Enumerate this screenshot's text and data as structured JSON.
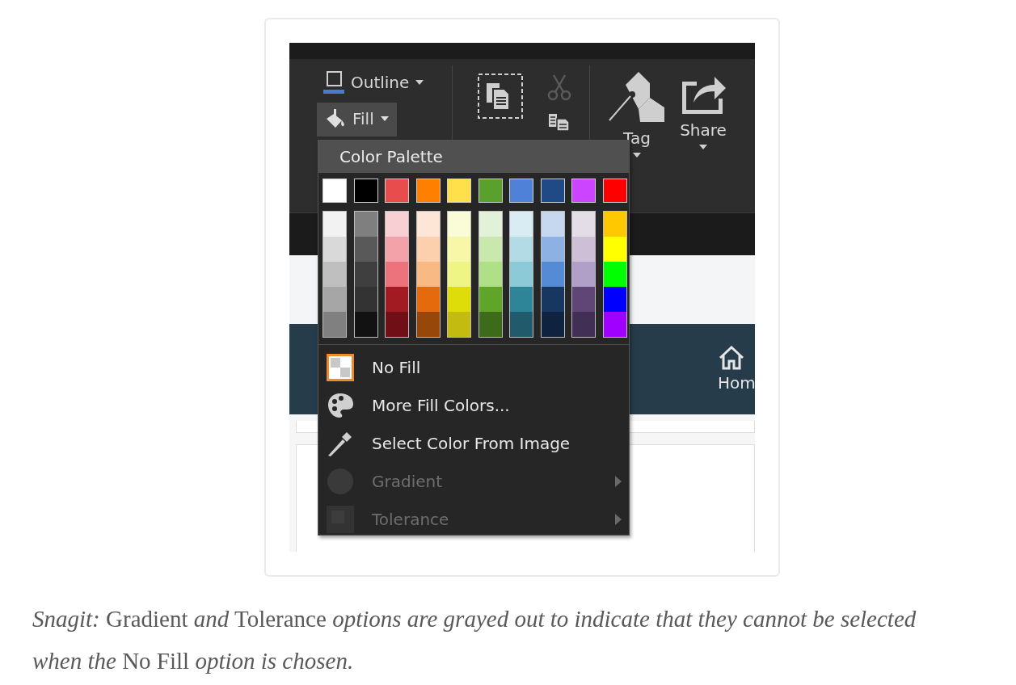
{
  "ribbon": {
    "outline": {
      "label": "Outline"
    },
    "fill": {
      "label": "Fill",
      "pressed": true
    },
    "tag": {
      "label": "Tag"
    },
    "share": {
      "label": "Share"
    }
  },
  "home_tab": {
    "label": "Hom"
  },
  "menu": {
    "title": "Color Palette",
    "base_colors": [
      {
        "color": "#ffffff"
      },
      {
        "color": "#000000"
      },
      {
        "color": "#e84c4c"
      },
      {
        "color": "#ff8000"
      },
      {
        "color": "#ffe04a"
      },
      {
        "color": "#5aa02c"
      },
      {
        "color": "#4f81d8"
      },
      {
        "color": "#1f4a86"
      },
      {
        "color": "#cc44ff"
      },
      {
        "color": "#ff0000"
      }
    ],
    "shade_columns": [
      {
        "swatches": [
          {
            "color": "#f2f2f2"
          },
          {
            "color": "#d9d9d9"
          },
          {
            "color": "#bfbfbf"
          },
          {
            "color": "#a6a6a6"
          },
          {
            "color": "#808080"
          }
        ]
      },
      {
        "swatches": [
          {
            "color": "#7f7f7f"
          },
          {
            "color": "#595959"
          },
          {
            "color": "#3f3f3f"
          },
          {
            "color": "#333333"
          },
          {
            "color": "#121212"
          }
        ]
      },
      {
        "swatches": [
          {
            "color": "#f8d0d3"
          },
          {
            "color": "#f2a2a8"
          },
          {
            "color": "#ec737c"
          },
          {
            "color": "#a31b22"
          },
          {
            "color": "#700f15"
          }
        ]
      },
      {
        "swatches": [
          {
            "color": "#fde6d6"
          },
          {
            "color": "#fcd0ad"
          },
          {
            "color": "#f9b984"
          },
          {
            "color": "#e56a0c"
          },
          {
            "color": "#974709"
          }
        ]
      },
      {
        "swatches": [
          {
            "color": "#fafcd8"
          },
          {
            "color": "#f8f7a8"
          },
          {
            "color": "#eef585"
          },
          {
            "color": "#dedd0a"
          },
          {
            "color": "#c3bb10"
          }
        ]
      },
      {
        "swatches": [
          {
            "color": "#e2f2d8"
          },
          {
            "color": "#c8e8ad"
          },
          {
            "color": "#afe085"
          },
          {
            "color": "#5ea528"
          },
          {
            "color": "#3c6b1a"
          }
        ]
      },
      {
        "swatches": [
          {
            "color": "#d9ecf3"
          },
          {
            "color": "#b2dbe6"
          },
          {
            "color": "#8ccad8"
          },
          {
            "color": "#2f8598"
          },
          {
            "color": "#205a6b"
          }
        ]
      },
      {
        "swatches": [
          {
            "color": "#c6d8f0"
          },
          {
            "color": "#8db1e2"
          },
          {
            "color": "#558ad4"
          },
          {
            "color": "#173660"
          },
          {
            "color": "#0f2240"
          }
        ]
      },
      {
        "swatches": [
          {
            "color": "#e3dde8"
          },
          {
            "color": "#ccbfd6"
          },
          {
            "color": "#b09fc6"
          },
          {
            "color": "#5f4676"
          },
          {
            "color": "#412f55"
          }
        ]
      },
      {
        "swatches": [
          {
            "color": "#ffc800"
          },
          {
            "color": "#ffff00"
          },
          {
            "color": "#00ff00"
          },
          {
            "color": "#0000ff"
          },
          {
            "color": "#a000ff"
          }
        ]
      }
    ],
    "items": [
      {
        "kind": "nofill",
        "label": "No Fill",
        "selected": true,
        "disabled": false,
        "submenu": false
      },
      {
        "kind": "palette",
        "label": "More Fill Colors...",
        "selected": false,
        "disabled": false,
        "submenu": false
      },
      {
        "kind": "picker",
        "label": "Select Color From Image",
        "selected": false,
        "disabled": false,
        "submenu": false
      },
      {
        "kind": "gradient",
        "label": "Gradient",
        "selected": false,
        "disabled": true,
        "submenu": true
      },
      {
        "kind": "tolerance",
        "label": "Tolerance",
        "selected": false,
        "disabled": true,
        "submenu": true
      }
    ]
  },
  "caption": "*Snagit:* Gradient *and* Tolerance *options are grayed out to indicate that they cannot be selected when the* No Fill *option is chosen.*"
}
